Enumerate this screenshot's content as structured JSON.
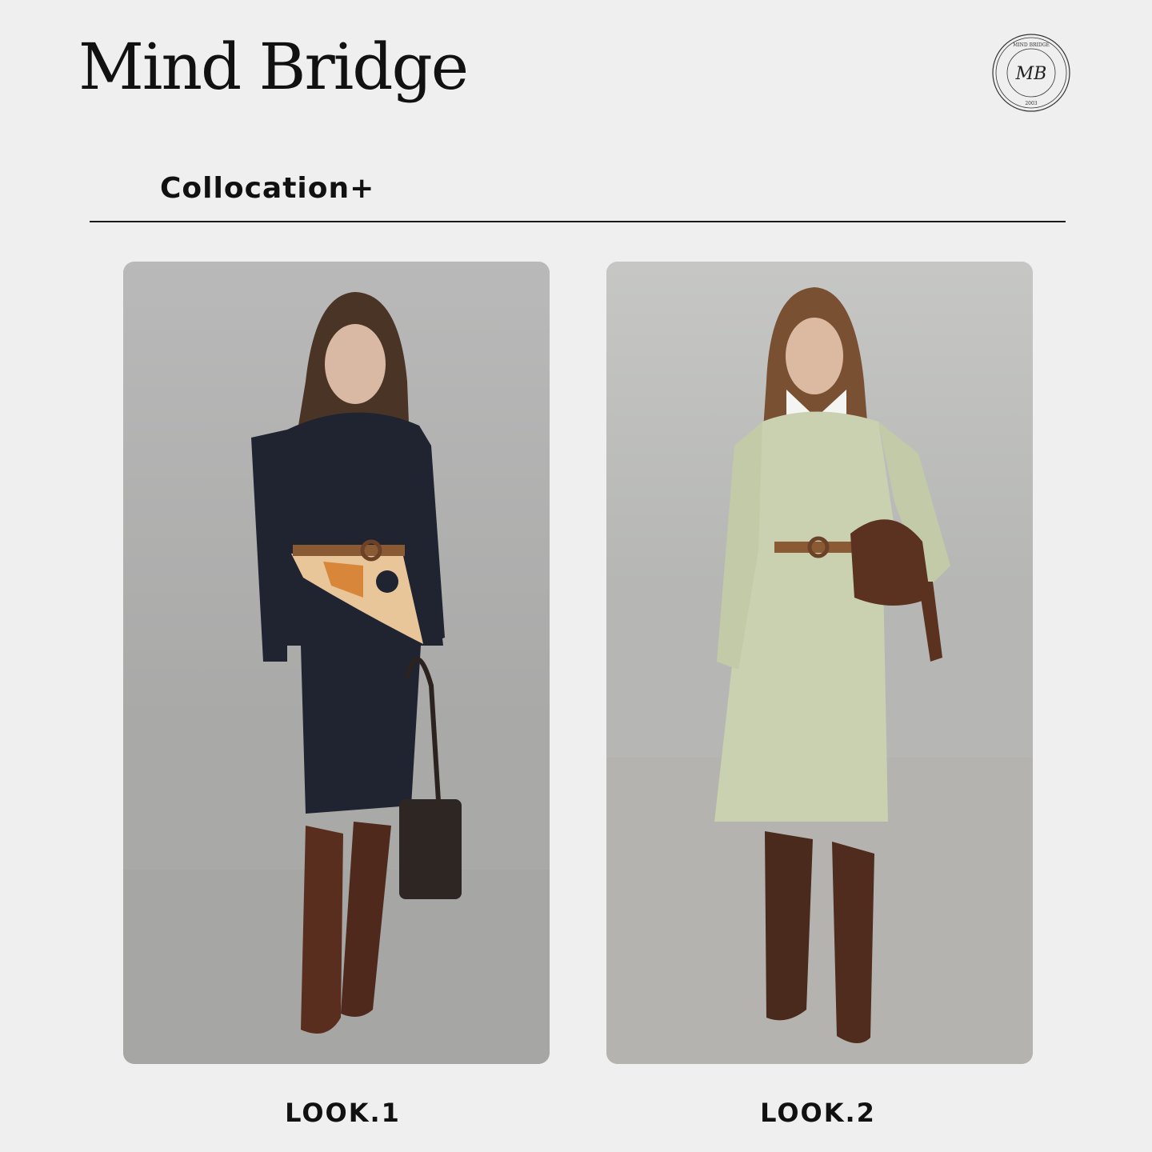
{
  "brand": {
    "name": "Mind Bridge",
    "seal_monogram": "MB",
    "seal_text": "MIND BRIDGE",
    "seal_year": "2003"
  },
  "section": {
    "title": "Collocation+"
  },
  "looks": [
    {
      "label": "LOOK.1"
    },
    {
      "label": "LOOK.2"
    }
  ]
}
